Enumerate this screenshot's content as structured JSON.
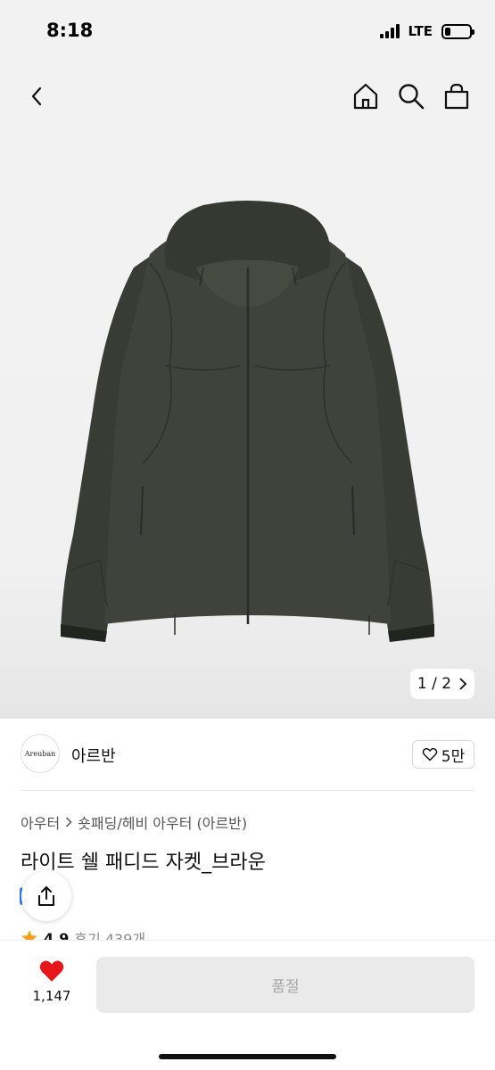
{
  "status": {
    "time": "8:18",
    "network": "LTE"
  },
  "nav": {
    "back": "chevron-left-icon",
    "home": "home-icon",
    "search": "search-icon",
    "bag": "shopping-bag-icon"
  },
  "gallery": {
    "current": "1",
    "total": "2",
    "separator": "/",
    "pager_text": "1 / 2",
    "image": "dark olive hooded padded jacket"
  },
  "brand": {
    "logo_text": "Areuban",
    "name": "아르반",
    "likes": "5만"
  },
  "breadcrumb": {
    "parent": "아우터",
    "child": "숏패딩/헤비 아우터 (아르반)"
  },
  "product": {
    "title": "라이트 쉘 패디드 자켓_브라운"
  },
  "rating": {
    "score": "4.9",
    "reviews": "후기 439개"
  },
  "bottom": {
    "wish_count": "1,147",
    "cta": "품절"
  },
  "colors": {
    "accent": "#e8151b",
    "star": "#f0a01c",
    "jacket": "#3c4038"
  }
}
